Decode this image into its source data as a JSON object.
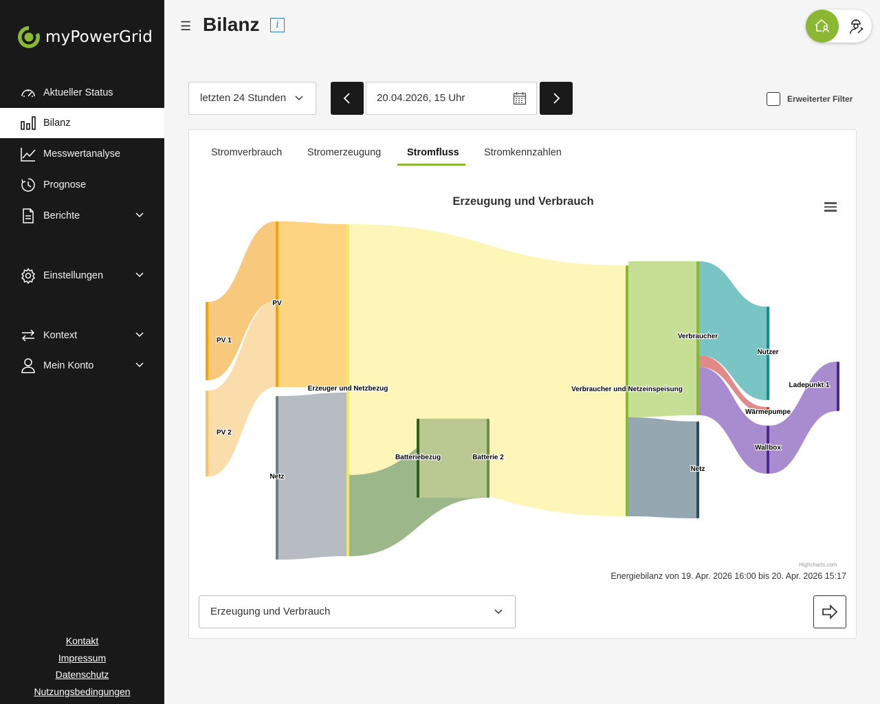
{
  "app": {
    "logo_text": "myPowerGrid",
    "brand_color": "#8ab833"
  },
  "sidebar": {
    "items": [
      {
        "label": "Aktueller Status",
        "icon": "gauge-icon"
      },
      {
        "label": "Bilanz",
        "icon": "bar-chart-icon",
        "active": true
      },
      {
        "label": "Messwertanalyse",
        "icon": "line-chart-icon"
      },
      {
        "label": "Prognose",
        "icon": "clock-forecast-icon"
      },
      {
        "label": "Berichte",
        "icon": "document-icon",
        "expandable": true
      },
      {
        "label": "Einstellungen",
        "icon": "gear-icon",
        "expandable": true
      },
      {
        "label": "Kontext",
        "icon": "swap-arrows-icon",
        "expandable": true
      },
      {
        "label": "Mein Konto",
        "icon": "user-icon",
        "expandable": true
      }
    ],
    "footer_links": [
      "Kontakt",
      "Impressum",
      "Datenschutz",
      "Nutzungsbedingungen"
    ]
  },
  "header": {
    "title": "Bilanz",
    "info_glyph": "i"
  },
  "filters": {
    "period": "letzten 24 Stunden",
    "date": "20.04.2026, 15 Uhr",
    "extended_filter_label": "Erweiterter Filter",
    "extended_filter_checked": false
  },
  "tabs": [
    {
      "label": "Stromverbrauch"
    },
    {
      "label": "Stromerzeugung"
    },
    {
      "label": "Stromfluss",
      "active": true
    },
    {
      "label": "Stromkennzahlen"
    }
  ],
  "chart": {
    "credits": "Highcharts.com",
    "caption": "Energiebilanz von 19. Apr. 2026 16:00 bis 20. Apr. 2026 15:17"
  },
  "chart_data": {
    "type": "sankey",
    "title": "Erzeugung und Verbrauch",
    "nodes": [
      "PV 1",
      "PV 2",
      "PV",
      "Netz",
      "Erzeuger und Netzbezug",
      "Batteriebezug",
      "Batterie 2",
      "Verbraucher und Netzeinspeisung",
      "Verbraucher",
      "Netz",
      "Nutzer",
      "Wärmepumpe",
      "Wallbox",
      "Ladepunkt 1"
    ],
    "links": [
      {
        "from": "PV 1",
        "to": "PV",
        "weight": 115
      },
      {
        "from": "PV 2",
        "to": "PV",
        "weight": 128
      },
      {
        "from": "PV",
        "to": "Erzeuger und Netzbezug",
        "weight": 243
      },
      {
        "from": "Netz",
        "to": "Erzeuger und Netzbezug",
        "weight": 238
      },
      {
        "from": "Erzeuger und Netzbezug",
        "to": "Verbraucher und Netzeinspeisung",
        "weight": 365
      },
      {
        "from": "Erzeuger und Netzbezug",
        "to": "Batterie 2",
        "weight": 116
      },
      {
        "from": "Batteriebezug",
        "to": "Batterie 2",
        "weight": 116
      },
      {
        "from": "Verbraucher und Netzeinspeisung",
        "to": "Verbraucher",
        "weight": 224
      },
      {
        "from": "Verbraucher und Netzeinspeisung",
        "to": "Netz",
        "weight": 141
      },
      {
        "from": "Verbraucher",
        "to": "Nutzer",
        "weight": 136
      },
      {
        "from": "Verbraucher",
        "to": "Wärmepumpe",
        "weight": 16
      },
      {
        "from": "Verbraucher",
        "to": "Wallbox",
        "weight": 72
      },
      {
        "from": "Wallbox",
        "to": "Ladepunkt 1",
        "weight": 72
      }
    ]
  },
  "view_select": {
    "value": "Erzeugung und Verbrauch"
  }
}
